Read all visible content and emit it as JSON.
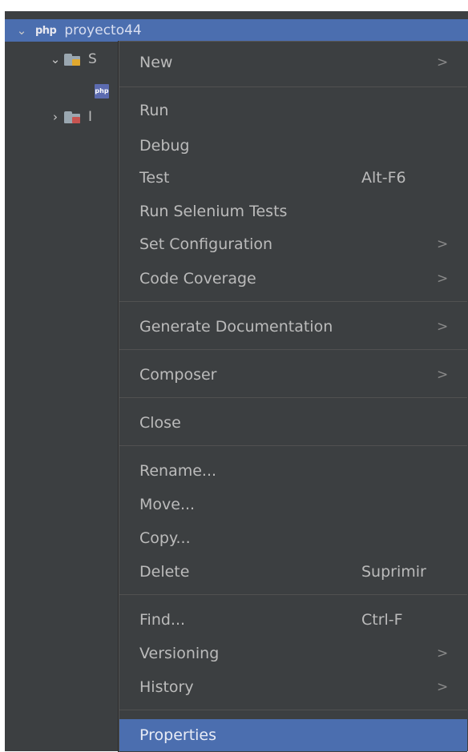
{
  "tree": {
    "project": {
      "badge": "php",
      "name": "proyecto44"
    },
    "source_partial": "S",
    "include_partial": "I",
    "file_badge": "php"
  },
  "menu": {
    "items": [
      {
        "label": "New",
        "shortcut": "",
        "submenu": true
      },
      {
        "label": "Run",
        "shortcut": "",
        "submenu": false
      },
      {
        "label": "Debug",
        "shortcut": "",
        "submenu": false
      },
      {
        "label": "Test",
        "shortcut": "Alt-F6",
        "submenu": false
      },
      {
        "label": "Run Selenium Tests",
        "shortcut": "",
        "submenu": false
      },
      {
        "label": "Set Configuration",
        "shortcut": "",
        "submenu": true
      },
      {
        "label": "Code Coverage",
        "shortcut": "",
        "submenu": true
      },
      {
        "label": "Generate Documentation",
        "shortcut": "",
        "submenu": true
      },
      {
        "label": "Composer",
        "shortcut": "",
        "submenu": true
      },
      {
        "label": "Close",
        "shortcut": "",
        "submenu": false
      },
      {
        "label": "Rename...",
        "shortcut": "",
        "submenu": false
      },
      {
        "label": "Move...",
        "shortcut": "",
        "submenu": false
      },
      {
        "label": "Copy...",
        "shortcut": "",
        "submenu": false
      },
      {
        "label": "Delete",
        "shortcut": "Suprimir",
        "submenu": false
      },
      {
        "label": "Find...",
        "shortcut": "Ctrl-F",
        "submenu": false
      },
      {
        "label": "Versioning",
        "shortcut": "",
        "submenu": true
      },
      {
        "label": "History",
        "shortcut": "",
        "submenu": true
      },
      {
        "label": "Properties",
        "shortcut": "",
        "submenu": false,
        "selected": true
      }
    ],
    "arrow_glyph": ">"
  },
  "colors": {
    "panel_bg": "#3c3f41",
    "selection": "#4b6eaf",
    "text": "#bbbbbb",
    "separator": "#515151"
  }
}
